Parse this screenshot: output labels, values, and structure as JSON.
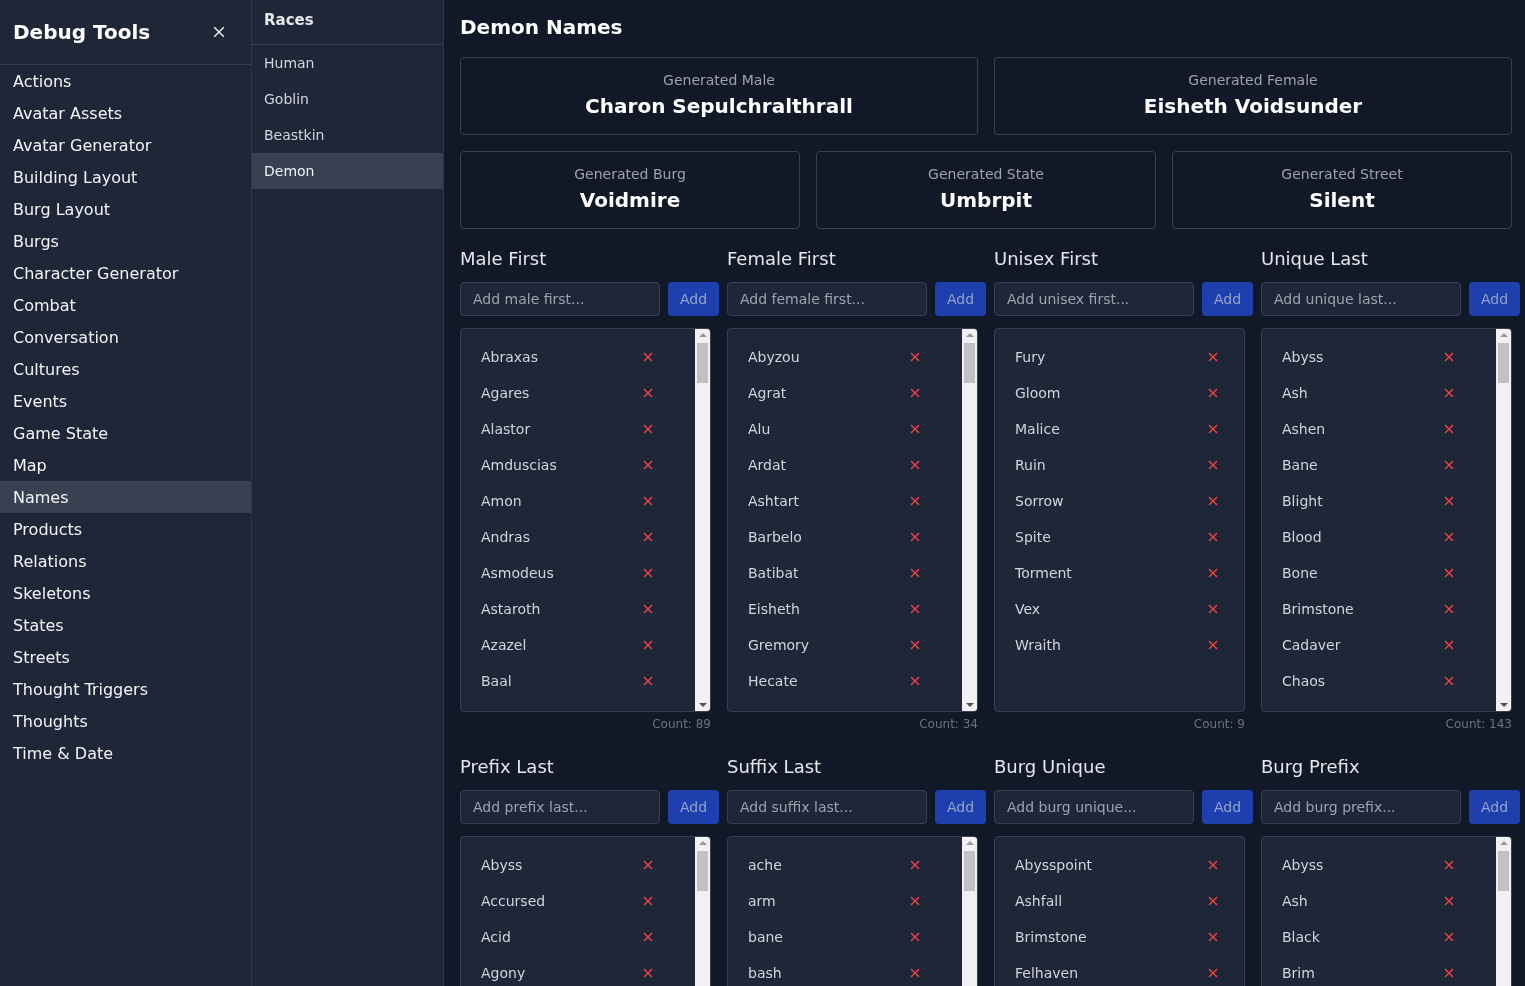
{
  "sidebar": {
    "title": "Debug Tools",
    "items": [
      {
        "label": "Actions",
        "selected": false
      },
      {
        "label": "Avatar Assets",
        "selected": false
      },
      {
        "label": "Avatar Generator",
        "selected": false
      },
      {
        "label": "Building Layout",
        "selected": false
      },
      {
        "label": "Burg Layout",
        "selected": false
      },
      {
        "label": "Burgs",
        "selected": false
      },
      {
        "label": "Character Generator",
        "selected": false
      },
      {
        "label": "Combat",
        "selected": false
      },
      {
        "label": "Conversation",
        "selected": false
      },
      {
        "label": "Cultures",
        "selected": false
      },
      {
        "label": "Events",
        "selected": false
      },
      {
        "label": "Game State",
        "selected": false
      },
      {
        "label": "Map",
        "selected": false
      },
      {
        "label": "Names",
        "selected": true
      },
      {
        "label": "Products",
        "selected": false
      },
      {
        "label": "Relations",
        "selected": false
      },
      {
        "label": "Skeletons",
        "selected": false
      },
      {
        "label": "States",
        "selected": false
      },
      {
        "label": "Streets",
        "selected": false
      },
      {
        "label": "Thought Triggers",
        "selected": false
      },
      {
        "label": "Thoughts",
        "selected": false
      },
      {
        "label": "Time & Date",
        "selected": false
      }
    ]
  },
  "races": {
    "title": "Races",
    "items": [
      {
        "label": "Human",
        "selected": false
      },
      {
        "label": "Goblin",
        "selected": false
      },
      {
        "label": "Beastkin",
        "selected": false
      },
      {
        "label": "Demon",
        "selected": true
      }
    ]
  },
  "main": {
    "title": "Demon Names",
    "generated_rows": [
      [
        {
          "label": "Generated Male",
          "value": "Charon Sepulchralthrall"
        },
        {
          "label": "Generated Female",
          "value": "Eisheth Voidsunder"
        }
      ],
      [
        {
          "label": "Generated Burg",
          "value": "Voidmire"
        },
        {
          "label": "Generated State",
          "value": "Umbrpit"
        },
        {
          "label": "Generated Street",
          "value": "Silent"
        }
      ]
    ],
    "lists": [
      {
        "title": "Male First",
        "placeholder": "Add male first...",
        "button": "Add",
        "scrollbar": true,
        "count": "Count: 89",
        "items": [
          "Abraxas",
          "Agares",
          "Alastor",
          "Amduscias",
          "Amon",
          "Andras",
          "Asmodeus",
          "Astaroth",
          "Azazel",
          "Baal"
        ]
      },
      {
        "title": "Female First",
        "placeholder": "Add female first...",
        "button": "Add",
        "scrollbar": true,
        "count": "Count: 34",
        "items": [
          "Abyzou",
          "Agrat",
          "Alu",
          "Ardat",
          "Ashtart",
          "Barbelo",
          "Batibat",
          "Eisheth",
          "Gremory",
          "Hecate"
        ]
      },
      {
        "title": "Unisex First",
        "placeholder": "Add unisex first...",
        "button": "Add",
        "scrollbar": false,
        "count": "Count: 9",
        "items": [
          "Fury",
          "Gloom",
          "Malice",
          "Ruin",
          "Sorrow",
          "Spite",
          "Torment",
          "Vex",
          "Wraith"
        ]
      },
      {
        "title": "Unique Last",
        "placeholder": "Add unique last...",
        "button": "Add",
        "scrollbar": true,
        "count": "Count: 143",
        "items": [
          "Abyss",
          "Ash",
          "Ashen",
          "Bane",
          "Blight",
          "Blood",
          "Bone",
          "Brimstone",
          "Cadaver",
          "Chaos"
        ]
      },
      {
        "title": "Prefix Last",
        "placeholder": "Add prefix last...",
        "button": "Add",
        "scrollbar": true,
        "items": [
          "Abyss",
          "Accursed",
          "Acid",
          "Agony"
        ]
      },
      {
        "title": "Suffix Last",
        "placeholder": "Add suffix last...",
        "button": "Add",
        "scrollbar": true,
        "items": [
          "ache",
          "arm",
          "bane",
          "bash"
        ]
      },
      {
        "title": "Burg Unique",
        "placeholder": "Add burg unique...",
        "button": "Add",
        "scrollbar": false,
        "items": [
          "Abysspoint",
          "Ashfall",
          "Brimstone",
          "Felhaven"
        ]
      },
      {
        "title": "Burg Prefix",
        "placeholder": "Add burg prefix...",
        "button": "Add",
        "scrollbar": true,
        "items": [
          "Abyss",
          "Ash",
          "Black",
          "Brim"
        ]
      }
    ]
  }
}
